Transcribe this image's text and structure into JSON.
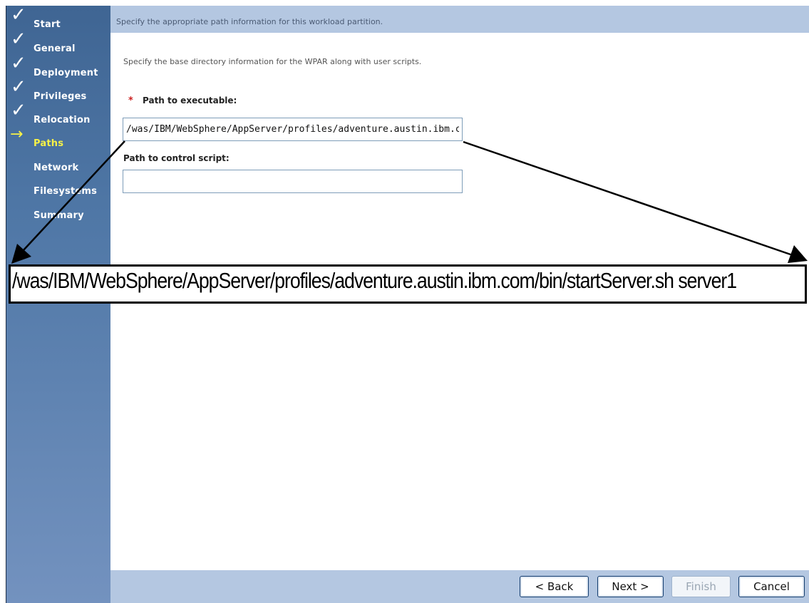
{
  "wizard": {
    "steps": [
      {
        "label": "Start",
        "state": "done"
      },
      {
        "label": "General",
        "state": "done"
      },
      {
        "label": "Deployment",
        "state": "done"
      },
      {
        "label": "Privileges",
        "state": "done"
      },
      {
        "label": "Relocation",
        "state": "done"
      },
      {
        "label": "Paths",
        "state": "current"
      },
      {
        "label": "Network",
        "state": "pending"
      },
      {
        "label": "Filesystems",
        "state": "pending"
      },
      {
        "label": "Summary",
        "state": "pending"
      }
    ],
    "done_icon": "check-icon",
    "current_icon": "right-arrow-icon"
  },
  "header": {
    "text": "Specify the appropriate path information for this workload partition."
  },
  "form": {
    "intro": "Specify the base directory information for the WPAR along with user scripts.",
    "required_marker": "*",
    "executable_label": "Path to executable:",
    "executable_value": "/was/IBM/WebSphere/AppServer/profiles/adventure.austin.ibm.com/bin/startServer.sh server1",
    "control_label": "Path to control script:",
    "control_value": ""
  },
  "callout": {
    "text": "/was/IBM/WebSphere/AppServer/profiles/adventure.austin.ibm.com/bin/startServer.sh server1"
  },
  "footer": {
    "back_label": "< Back",
    "next_label": "Next >",
    "finish_label": "Finish",
    "cancel_label": "Cancel"
  },
  "colors": {
    "sidebar_top": "#3f6593",
    "sidebar_bottom": "#7392bf",
    "band": "#b4c7e1",
    "current_step": "#f6f148",
    "required": "#cc2222"
  }
}
